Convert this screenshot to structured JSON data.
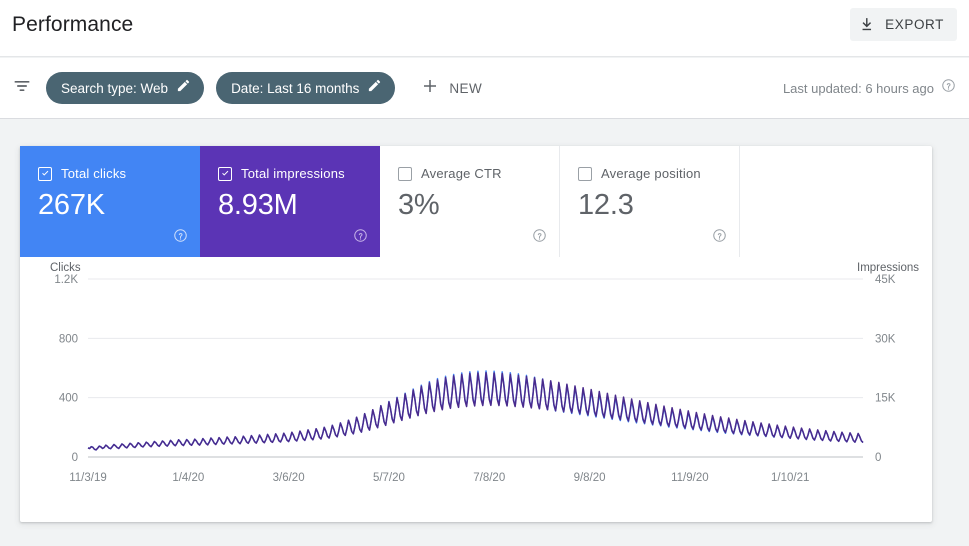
{
  "header": {
    "title": "Performance",
    "export_label": "EXPORT",
    "export_icon": "download-icon"
  },
  "filters": {
    "filter_icon": "funnel-icon",
    "chips": [
      {
        "label": "Search type: Web",
        "edit_icon": "pencil-icon"
      },
      {
        "label": "Date: Last 16 months",
        "edit_icon": "pencil-icon"
      }
    ],
    "new_label": "NEW",
    "new_icon": "plus-icon",
    "last_updated": "Last updated: 6 hours ago",
    "help_icon": "help-circle-icon"
  },
  "metrics": [
    {
      "name": "Total clicks",
      "value": "267K",
      "checked": true,
      "color": "#4285f4",
      "help_icon": "help-circle-icon"
    },
    {
      "name": "Total impressions",
      "value": "8.93M",
      "checked": true,
      "color": "#5b34b5",
      "help_icon": "help-circle-icon"
    },
    {
      "name": "Average CTR",
      "value": "3%",
      "checked": false,
      "color": "#ffffff",
      "help_icon": "help-circle-icon"
    },
    {
      "name": "Average position",
      "value": "12.3",
      "checked": false,
      "color": "#ffffff",
      "help_icon": "help-circle-icon"
    }
  ],
  "chart_data": {
    "type": "line",
    "title": "",
    "grid": true,
    "legend": "none",
    "xlabel": "",
    "ylabel": "Clicks",
    "y2label": "Impressions",
    "ylim": [
      0,
      1200
    ],
    "y2lim": [
      0,
      45000
    ],
    "yticks": [
      0,
      400,
      800,
      1200
    ],
    "ytick_labels": [
      "0",
      "400",
      "800",
      "1.2K"
    ],
    "y2ticks": [
      0,
      15000,
      30000,
      45000
    ],
    "y2tick_labels": [
      "0",
      "15K",
      "30K",
      "45K"
    ],
    "xtick_labels": [
      "11/3/19",
      "1/4/20",
      "3/6/20",
      "5/7/20",
      "7/8/20",
      "9/8/20",
      "11/9/20",
      "1/10/21"
    ],
    "xtick_positions": [
      0,
      62,
      124,
      186,
      248,
      310,
      372,
      434
    ],
    "n_points": 480,
    "series": [
      {
        "name": "Clicks",
        "axis": "left",
        "color": "#4285f4",
        "values": [
          62,
          58,
          70,
          66,
          52,
          48,
          60,
          74,
          68,
          58,
          64,
          80,
          72,
          60,
          56,
          70,
          84,
          76,
          64,
          58,
          72,
          88,
          80,
          68,
          62,
          76,
          92,
          84,
          70,
          64,
          78,
          96,
          88,
          74,
          68,
          82,
          100,
          92,
          78,
          70,
          86,
          104,
          96,
          80,
          72,
          88,
          108,
          98,
          82,
          74,
          90,
          112,
          100,
          84,
          76,
          94,
          116,
          104,
          86,
          78,
          96,
          118,
          106,
          88,
          80,
          98,
          120,
          108,
          90,
          82,
          100,
          124,
          110,
          92,
          84,
          102,
          128,
          114,
          94,
          86,
          104,
          130,
          116,
          96,
          88,
          106,
          134,
          118,
          98,
          90,
          108,
          136,
          120,
          100,
          92,
          110,
          140,
          124,
          102,
          94,
          112,
          144,
          126,
          104,
          96,
          116,
          148,
          130,
          106,
          98,
          118,
          152,
          132,
          108,
          100,
          120,
          156,
          136,
          110,
          102,
          124,
          160,
          140,
          114,
          104,
          128,
          166,
          146,
          118,
          108,
          134,
          174,
          152,
          124,
          112,
          140,
          182,
          158,
          128,
          116,
          146,
          190,
          166,
          134,
          122,
          154,
          200,
          174,
          140,
          128,
          164,
          214,
          186,
          150,
          136,
          176,
          230,
          200,
          160,
          146,
          190,
          248,
          216,
          172,
          156,
          206,
          268,
          234,
          186,
          168,
          224,
          292,
          254,
          202,
          182,
          244,
          318,
          276,
          220,
          198,
          266,
          346,
          300,
          238,
          214,
          288,
          374,
          324,
          258,
          232,
          310,
          402,
          348,
          276,
          248,
          332,
          430,
          372,
          294,
          264,
          354,
          458,
          396,
          312,
          280,
          374,
          484,
          418,
          330,
          296,
          392,
          508,
          438,
          346,
          310,
          408,
          528,
          456,
          360,
          322,
          420,
          544,
          470,
          372,
          332,
          430,
          556,
          480,
          380,
          340,
          438,
          566,
          488,
          386,
          346,
          444,
          574,
          494,
          392,
          350,
          448,
          578,
          498,
          394,
          352,
          450,
          580,
          500,
          396,
          354,
          450,
          578,
          498,
          394,
          352,
          448,
          574,
          494,
          390,
          348,
          444,
          568,
          488,
          386,
          344,
          438,
          560,
          482,
          380,
          340,
          430,
          550,
          472,
          374,
          334,
          420,
          538,
          462,
          366,
          326,
          410,
          526,
          452,
          358,
          318,
          400,
          512,
          440,
          348,
          310,
          388,
          498,
          428,
          340,
          302,
          378,
          484,
          416,
          330,
          294,
          368,
          470,
          404,
          320,
          286,
          356,
          456,
          392,
          312,
          278,
          346,
          442,
          380,
          302,
          270,
          336,
          428,
          368,
          294,
          262,
          326,
          416,
          358,
          284,
          254,
          316,
          402,
          346,
          276,
          246,
          306,
          390,
          336,
          266,
          238,
          296,
          378,
          326,
          258,
          230,
          288,
          366,
          316,
          250,
          224,
          278,
          354,
          306,
          242,
          216,
          270,
          344,
          296,
          234,
          210,
          262,
          332,
          286,
          226,
          202,
          252,
          322,
          278,
          220,
          196,
          244,
          312,
          268,
          212,
          190,
          236,
          302,
          260,
          206,
          184,
          228,
          292,
          252,
          200,
          178,
          222,
          282,
          244,
          192,
          172,
          214,
          272,
          234,
          186,
          166,
          206,
          264,
          228,
          180,
          160,
          200,
          256,
          220,
          174,
          156,
          194,
          248,
          214,
          170,
          150,
          188,
          240,
          206,
          164,
          146,
          182,
          232,
          200,
          158,
          142,
          176,
          226,
          194,
          154,
          138,
          170,
          218,
          188,
          148,
          134,
          164,
          210,
          182,
          144,
          130,
          160,
          204,
          176,
          140,
          126,
          154,
          198,
          170,
          136,
          122,
          150,
          192,
          166,
          132,
          118,
          146,
          186,
          160,
          128,
          114,
          142,
          180,
          156,
          124,
          112,
          138,
          176,
          152,
          120,
          108,
          134,
          170,
          148,
          118,
          106,
          130,
          166,
          144,
          114,
          102,
          126,
          162,
          140,
          112,
          100,
          124,
          158,
          136,
          108,
          98
        ]
      },
      {
        "name": "Impressions",
        "axis": "right",
        "color": "#4a2a8c",
        "values": [
          2300,
          2150,
          2600,
          2450,
          1950,
          1800,
          2250,
          2750,
          2550,
          2150,
          2400,
          3000,
          2700,
          2250,
          2100,
          2600,
          3150,
          2850,
          2400,
          2150,
          2700,
          3300,
          3000,
          2550,
          2300,
          2850,
          3450,
          3150,
          2600,
          2400,
          2900,
          3600,
          3300,
          2750,
          2550,
          3050,
          3750,
          3450,
          2900,
          2600,
          3200,
          3900,
          3600,
          3000,
          2700,
          3300,
          4050,
          3700,
          3050,
          2750,
          3350,
          4200,
          3750,
          3150,
          2850,
          3500,
          4350,
          3900,
          3200,
          2900,
          3600,
          4400,
          3950,
          3250,
          2950,
          3650,
          4500,
          4050,
          3350,
          3000,
          3700,
          4650,
          4100,
          3400,
          3050,
          3800,
          4800,
          4250,
          3500,
          3150,
          3900,
          4900,
          4350,
          3550,
          3250,
          3950,
          5050,
          4450,
          3650,
          3300,
          4050,
          5100,
          4500,
          3700,
          3350,
          4150,
          5250,
          4650,
          3800,
          3450,
          4200,
          5400,
          4700,
          3850,
          3500,
          4350,
          5550,
          4850,
          3950,
          3600,
          4450,
          5700,
          4950,
          4000,
          3700,
          4500,
          5850,
          5100,
          4100,
          3800,
          4650,
          6000,
          5250,
          4250,
          3900,
          4800,
          6250,
          5500,
          4400,
          4050,
          5050,
          6550,
          5700,
          4600,
          4200,
          5250,
          6850,
          5950,
          4800,
          4350,
          5500,
          7150,
          6250,
          5000,
          4550,
          5800,
          7500,
          6550,
          5250,
          4800,
          6150,
          8000,
          6950,
          5600,
          5100,
          6600,
          8600,
          7500,
          6000,
          5450,
          7100,
          9300,
          8100,
          6450,
          5850,
          7700,
          10050,
          8750,
          6950,
          6300,
          8400,
          10950,
          9500,
          7550,
          6800,
          9150,
          11950,
          10350,
          8250,
          7400,
          9950,
          12950,
          11200,
          8900,
          8000,
          10750,
          13950,
          12100,
          9600,
          8650,
          11550,
          14950,
          12950,
          10300,
          9250,
          12350,
          15950,
          13800,
          10950,
          9850,
          13150,
          16950,
          14700,
          11650,
          10450,
          13900,
          17900,
          15500,
          12250,
          11000,
          14550,
          18750,
          16200,
          12800,
          11500,
          15100,
          19450,
          16800,
          13300,
          11950,
          15550,
          20050,
          17300,
          13700,
          12300,
          15900,
          20500,
          17700,
          14000,
          12550,
          16150,
          20850,
          18000,
          14250,
          12750,
          16350,
          21100,
          18200,
          14400,
          12900,
          16450,
          21250,
          18350,
          14500,
          13000,
          16500,
          21300,
          18400,
          14550,
          13050,
          16500,
          21250,
          18350,
          14500,
          13000,
          16400,
          21100,
          18200,
          14400,
          12900,
          16300,
          20900,
          18000,
          14250,
          12750,
          16150,
          20650,
          17800,
          14100,
          12600,
          15950,
          20350,
          17550,
          13900,
          12400,
          15700,
          20000,
          17250,
          13650,
          12200,
          15400,
          19650,
          16950,
          13400,
          11950,
          15100,
          19250,
          16600,
          13150,
          11700,
          14750,
          18850,
          16250,
          12850,
          11450,
          14400,
          18400,
          15850,
          12550,
          11200,
          14050,
          17950,
          15450,
          12250,
          10950,
          13700,
          17500,
          15050,
          11950,
          10650,
          13350,
          17050,
          14650,
          11600,
          10350,
          12950,
          16550,
          14250,
          11300,
          10050,
          12600,
          16100,
          13850,
          10950,
          9750,
          12200,
          15600,
          13400,
          10650,
          9450,
          11850,
          15150,
          13000,
          10300,
          9150,
          11450,
          14650,
          12600,
          9950,
          8900,
          11100,
          14200,
          12200,
          9650,
          8600,
          10750,
          13750,
          11800,
          9350,
          8300,
          10400,
          13300,
          11450,
          9050,
          8050,
          10050,
          12850,
          11050,
          8750,
          7800,
          9750,
          12450,
          10700,
          8450,
          7550,
          9400,
          12050,
          10350,
          8200,
          7300,
          9100,
          11650,
          10000,
          7900,
          7050,
          8800,
          11250,
          9700,
          7650,
          6850,
          8500,
          10900,
          9350,
          7400,
          6600,
          8250,
          10500,
          9050,
          7150,
          6400,
          7950,
          10150,
          8750,
          6900,
          6200,
          7700,
          9850,
          8450,
          6700,
          5950,
          7450,
          9500,
          8200,
          6450,
          5750,
          7200,
          9200,
          7900,
          6250,
          5600,
          6950,
          8900,
          7650,
          6050,
          5400,
          6750,
          8600,
          7400,
          5850,
          5250,
          6500,
          8350,
          7150,
          5650,
          5100,
          6300,
          8050,
          6950,
          5450,
          4950,
          6100,
          7800,
          6700,
          5300,
          4750,
          5900,
          7550,
          6500,
          5150,
          4600,
          5700,
          7300,
          6300,
          4950,
          4450,
          5550,
          7100,
          6100,
          4800,
          4300,
          5350,
          6850,
          5900,
          4650,
          4200,
          5200,
          6650,
          5750,
          4500,
          4050,
          5050,
          6450,
          5600,
          4400,
          3950,
          4900,
          6250,
          5450,
          4300,
          3850,
          4750,
          6100,
          5300,
          4200,
          3750,
          4650,
          5950,
          5150,
          4100,
          3650
        ]
      }
    ]
  }
}
